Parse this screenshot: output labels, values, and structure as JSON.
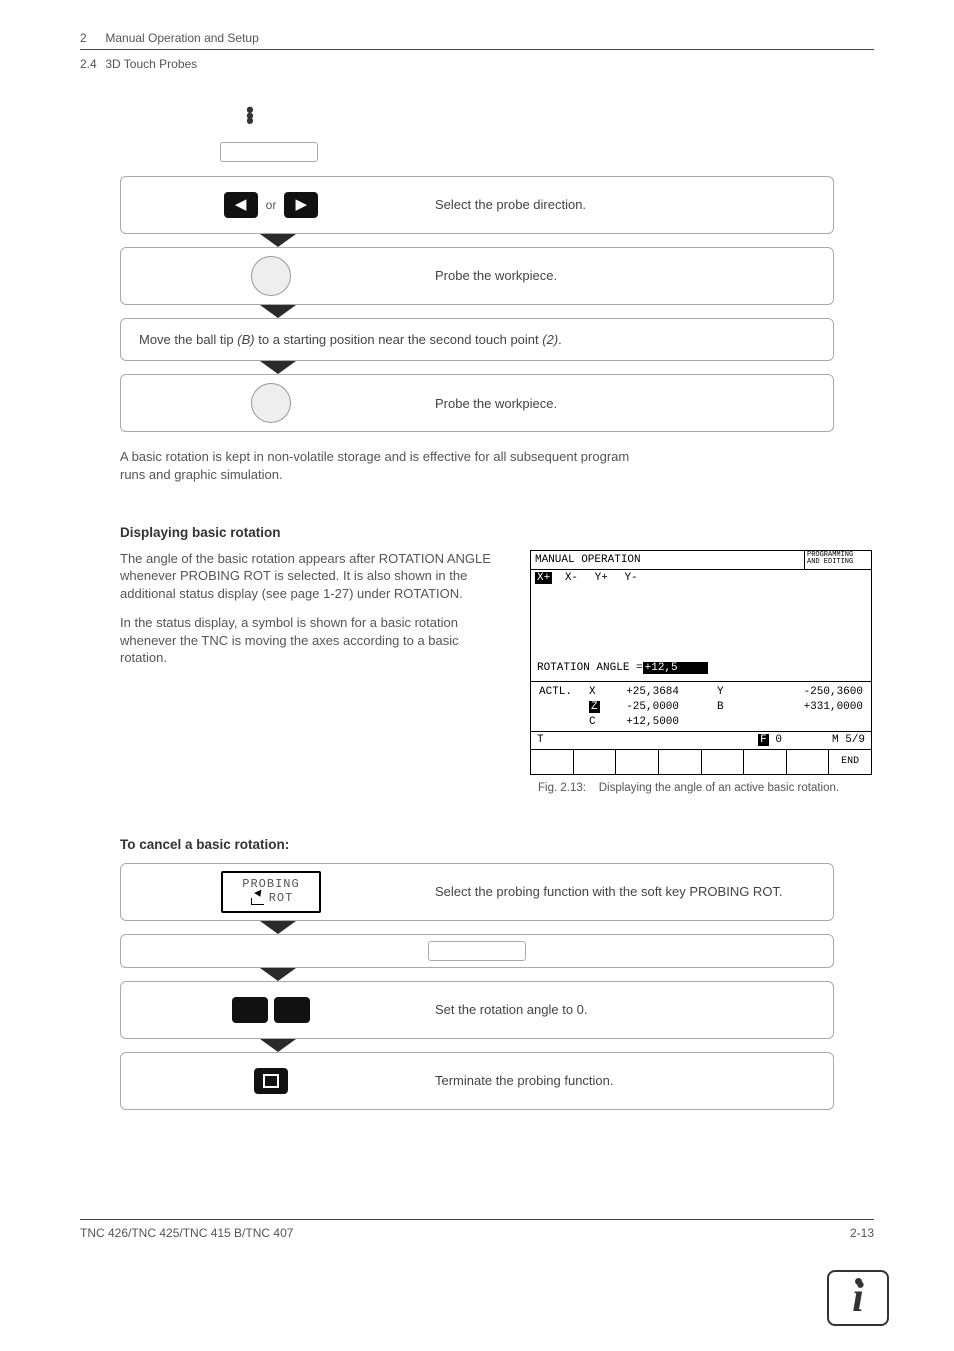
{
  "header": {
    "chapter_num": "2",
    "chapter_title": "Manual Operation and Setup",
    "section_num": "2.4",
    "section_title": "3D Touch Probes"
  },
  "steps": {
    "or_label": "or",
    "s1_text": "Select the probe direction.",
    "s2_text": "Probe the workpiece.",
    "full_prefix": "Move the ball tip ",
    "full_b": "(B)",
    "full_mid": " to a starting position near the second touch point ",
    "full_2": "(2)",
    "full_suffix": ".",
    "s3_text": "Probe the workpiece."
  },
  "note_after": "A basic rotation is kept in non-volatile storage and is effective for all subsequent program runs and graphic simulation.",
  "display_section": {
    "heading": "Displaying basic rotation",
    "para1": "The angle of the basic rotation appears after ROTATION ANGLE whenever PROBING ROT is selected. It is also shown in the additional status display (see page 1-27) under ROTATION.",
    "para2": "In the status display, a symbol is shown for a basic rotation whenever the TNC is moving the axes according to a basic rotation."
  },
  "screen": {
    "title": "MANUAL OPERATION",
    "mode1": "PROGRAMMING",
    "mode2": "AND EDITING",
    "axis_labels": {
      "xp": "X+",
      "xm": "X-",
      "yp": "Y+",
      "ym": "Y-"
    },
    "rot_label": "ROTATION ANGLE =",
    "rot_value": "+12,5",
    "actl_label": "ACTL.",
    "vals": {
      "X": "+25,3684",
      "Z": "-25,0000",
      "C": "+12,5000",
      "Y": "-250,3600",
      "B": "+331,0000"
    },
    "T": "T",
    "F_label": "F",
    "F_val": "0",
    "M_label": "M",
    "M_val": "5/9",
    "end": "END"
  },
  "figcap_label": "Fig. 2.13:",
  "figcap_text": "Displaying the angle of an active basic rotation.",
  "cancel": {
    "heading": "To cancel a basic rotation:",
    "sk_line1": "PROBING",
    "sk_line2": "ROT",
    "s1": "Select the probing function with the soft key PROBING ROT.",
    "s2": "Set the rotation angle to 0.",
    "s3": "Terminate the probing function."
  },
  "footer": {
    "left": "TNC 426/TNC 425/TNC 415 B/TNC 407",
    "right": "2-13"
  }
}
